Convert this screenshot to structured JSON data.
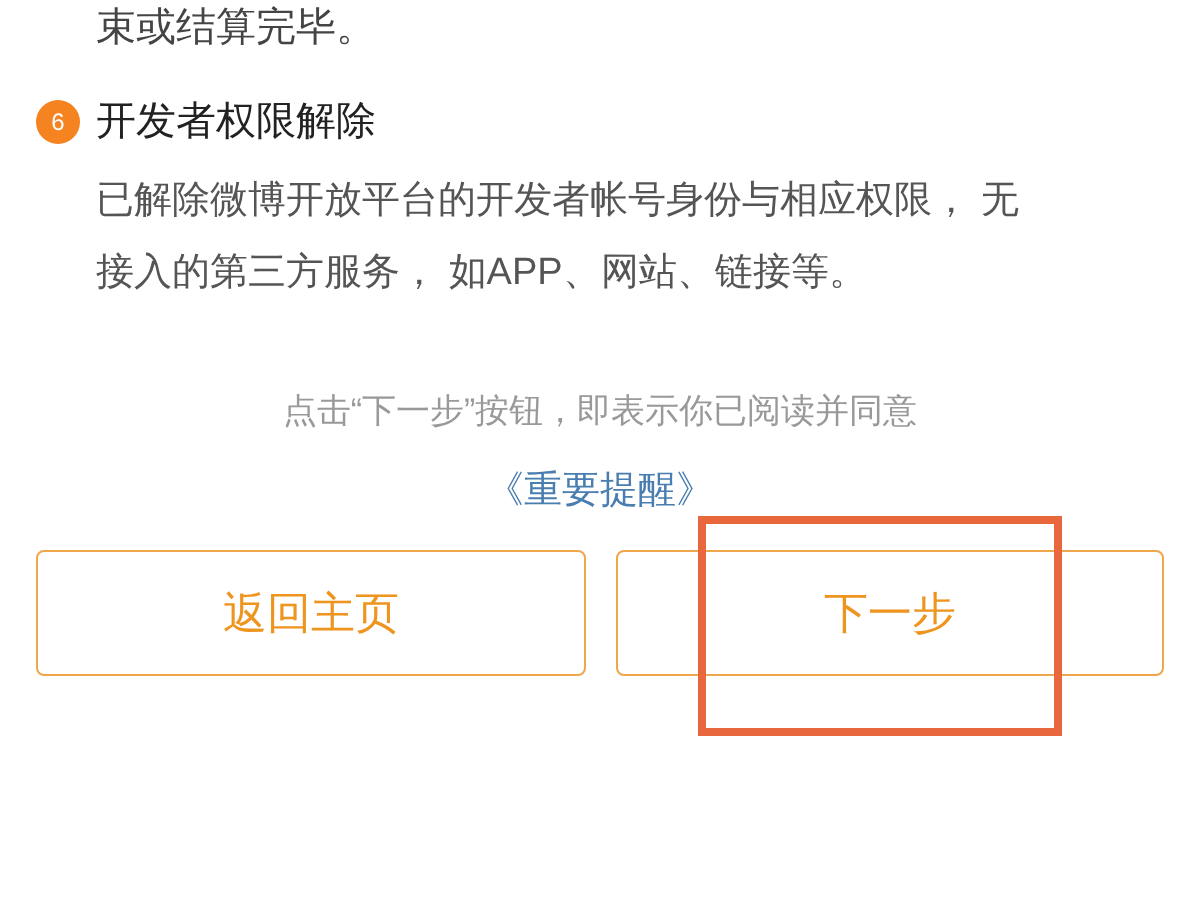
{
  "intro_tail": "束或结算完毕。",
  "section": {
    "number": "6",
    "title": "开发者权限解除",
    "body": "已解除微博开放平台的开发者帐号身份与相应权限， 无接入的第三方服务， 如APP、网站、链接等。"
  },
  "consent": {
    "text": "点击“下一步”按钮，即表示你已阅读并同意",
    "link": "《重要提醒》"
  },
  "buttons": [
    {
      "label": "返回主页",
      "highlighted": false
    },
    {
      "label": "下一步",
      "highlighted": true
    }
  ]
}
